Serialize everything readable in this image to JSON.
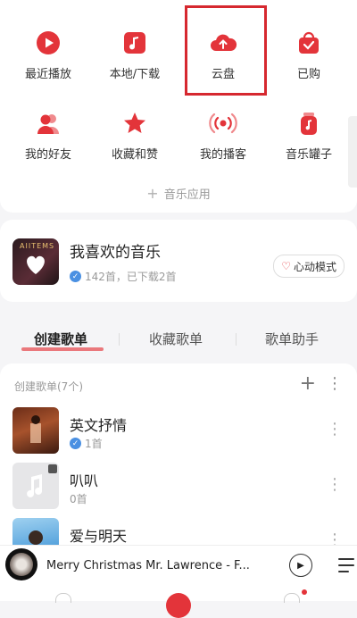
{
  "grid": {
    "row1": [
      {
        "label": "最近播放",
        "icon": "play-circle-icon"
      },
      {
        "label": "本地/下载",
        "icon": "music-note-icon"
      },
      {
        "label": "云盘",
        "icon": "cloud-upload-icon"
      },
      {
        "label": "已购",
        "icon": "bag-check-icon"
      }
    ],
    "row2": [
      {
        "label": "我的好友",
        "icon": "friends-icon"
      },
      {
        "label": "收藏和赞",
        "icon": "star-icon"
      },
      {
        "label": "我的播客",
        "icon": "broadcast-icon"
      },
      {
        "label": "音乐罐子",
        "icon": "music-jar-icon"
      }
    ],
    "more_apps": "音乐应用"
  },
  "favorites": {
    "title": "我喜欢的音乐",
    "subtitle": "142首，已下载2首",
    "cover_text": "AIITEMS",
    "mode_button": "心动模式"
  },
  "tabs": [
    "创建歌单",
    "收藏歌单",
    "歌单助手"
  ],
  "playlists": {
    "header": "创建歌单(7个)",
    "items": [
      {
        "name": "英文抒情",
        "meta": "1首",
        "verified": true
      },
      {
        "name": "叭叭",
        "meta": "0首",
        "verified": false
      },
      {
        "name": "爱与明天",
        "meta": "",
        "verified": false
      }
    ]
  },
  "player": {
    "title": "Merry Christmas Mr. Lawrence - F..."
  },
  "colors": {
    "accent": "#e3343a",
    "highlight": "#d6282f"
  }
}
